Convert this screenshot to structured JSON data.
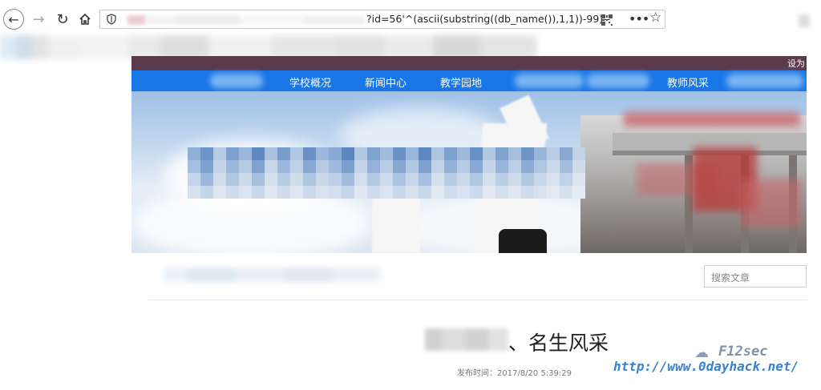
{
  "browser": {
    "url_visible": "?id=56'^(ascii(substring((db_name()),1,1))-99)--",
    "icons": [
      "back-icon",
      "forward-icon",
      "reload-icon",
      "home-icon",
      "shield-icon",
      "qr-code-icon",
      "more-icon",
      "bookmark-star-icon"
    ]
  },
  "site": {
    "topbar_text": "设为",
    "nav": {
      "items": [
        {
          "label": "学校概况"
        },
        {
          "label": "新闻中心"
        },
        {
          "label": "教学园地"
        },
        {
          "label": "教师风采"
        }
      ]
    },
    "search": {
      "placeholder": "搜索文章"
    },
    "article": {
      "title": "、名生风采",
      "meta": "发布时间：2017/8/20 5:39:29"
    }
  },
  "watermark": {
    "brand": "F12sec",
    "url": "http://www.0dayhack.net/"
  },
  "colors": {
    "nav_blue": "#1876e6",
    "topbar": "#5a3a4c",
    "watermark_url": "#3a82cc"
  }
}
